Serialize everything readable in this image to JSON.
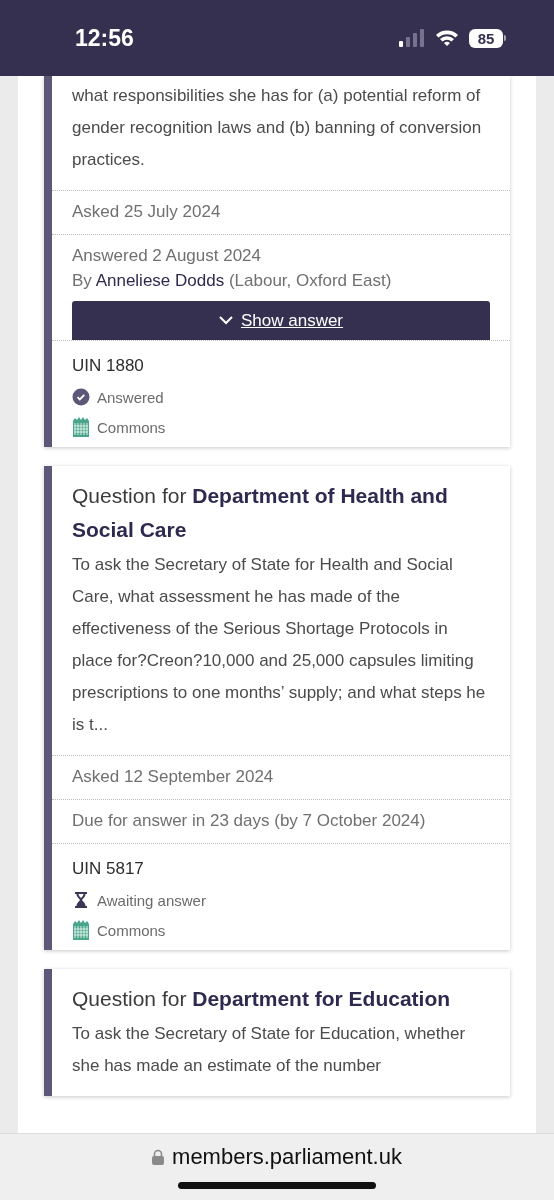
{
  "status_bar": {
    "time": "12:56",
    "battery": "85"
  },
  "questions": [
    {
      "body": "what responsibilities she has for (a) potential reform of gender recognition laws and (b) banning of conversion practices.",
      "asked": "Asked 25 July 2024",
      "answer_info": {
        "date": "Answered 2 August 2024",
        "by": "By",
        "member": "Anneliese Dodds",
        "party": "(Labour, Oxford East)",
        "button": "Show answer"
      },
      "uin": "UIN 1880",
      "status": {
        "kind": "answered",
        "label": "Answered"
      },
      "house": "Commons"
    },
    {
      "title_prefix": "Question for",
      "department": "Department of Health and Social Care",
      "body": "To ask the Secretary of State for Health and Social Care, what assessment he has made of the effectiveness of the Serious Shortage Protocols in place for?Creon?10,000 and 25,000 capsules limiting prescriptions to one months’ supply; and what steps he is t...",
      "asked": "Asked 12 September 2024",
      "due": "Due for answer in 23 days (by 7 October 2024)",
      "uin": "UIN 5817",
      "status": {
        "kind": "awaiting",
        "label": "Awaiting answer"
      },
      "house": "Commons"
    },
    {
      "title_prefix": "Question for",
      "department": "Department for Education",
      "body": "To ask the Secretary of State for Education, whether she has made an estimate of the number"
    }
  ],
  "url_bar": {
    "url": "members.parliament.uk"
  }
}
